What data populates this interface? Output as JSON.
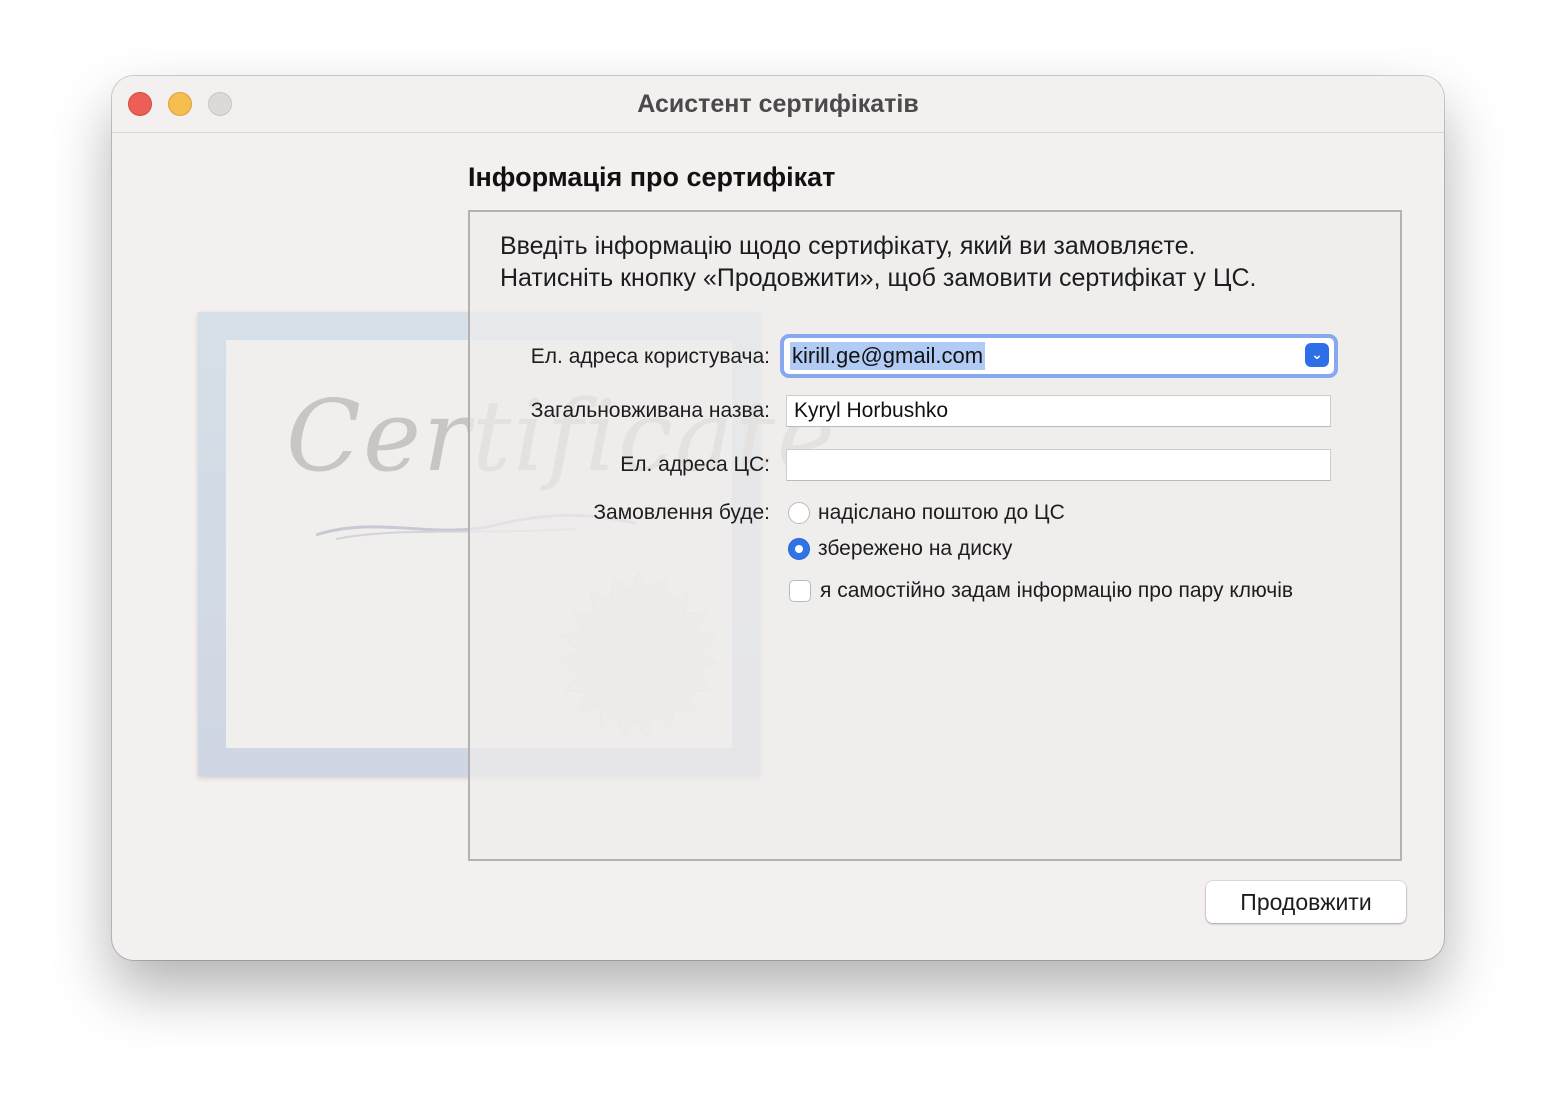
{
  "window": {
    "title": "Асистент сертифікатів"
  },
  "section_title": "Інформація про сертифікат",
  "intro": {
    "line1": "Введіть інформацію щодо сертифікату, який ви замовляєте.",
    "line2": "Натисніть кнопку «Продовжити», щоб замовити сертифікат у ЦС."
  },
  "form": {
    "email_label": "Ел. адреса користувача:",
    "email_value": "kirill.ge@gmail.com",
    "common_name_label": "Загальновживана назва:",
    "common_name_value": "Kyryl Horbushko",
    "ca_email_label": "Ел. адреса ЦС:",
    "ca_email_value": "",
    "request_label": "Замовлення буде:",
    "option_emailed": "надіслано поштою до ЦС",
    "option_saved": "збережено на диску",
    "option_selected": "збережено на диску",
    "keypair_label": "я самостійно задам інформацію про пару ключів",
    "keypair_checked": false
  },
  "background_art": {
    "text": "Certificate"
  },
  "buttons": {
    "continue": "Продовжити"
  },
  "colors": {
    "accent": "#2f74e6",
    "focus_ring": "#87a7ee",
    "selection": "#b2cbf5",
    "close": "#ec5f57",
    "minimize": "#f5be4e",
    "zoom_inactive": "#dcd9d8"
  }
}
